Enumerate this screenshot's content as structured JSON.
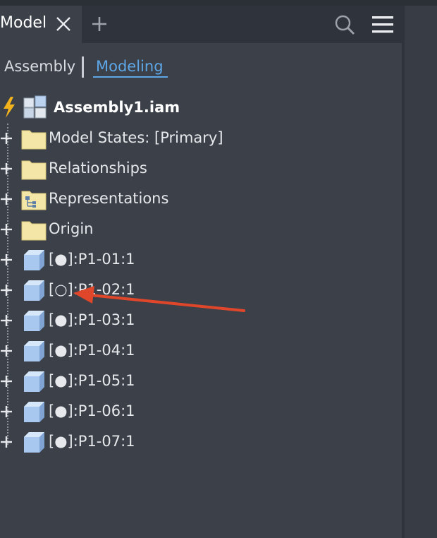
{
  "tabs": {
    "active_label": "Model",
    "close_icon": "close-icon",
    "add_icon": "plus-icon"
  },
  "toolbar": {
    "search_icon": "search-icon",
    "menu_icon": "hamburger-menu-icon"
  },
  "modes": {
    "assembly_label": "Assembly",
    "modeling_label": "Modeling",
    "active": "Modeling"
  },
  "tree": {
    "root": {
      "label": "Assembly1.iam",
      "icons": [
        "lightning-icon",
        "assembly-icon"
      ]
    },
    "items": [
      {
        "label": "Model States: [Primary]",
        "icon": "folder-icon"
      },
      {
        "label": "Relationships",
        "icon": "folder-icon"
      },
      {
        "label": "Representations",
        "icon": "representations-folder-icon"
      },
      {
        "label": "Origin",
        "icon": "folder-icon"
      },
      {
        "label": "[●]:P1-01:1",
        "icon": "part-cube-icon"
      },
      {
        "label": "[○]:P1-02:1",
        "icon": "part-cube-icon"
      },
      {
        "label": "[●]:P1-03:1",
        "icon": "part-cube-icon"
      },
      {
        "label": "[●]:P1-04:1",
        "icon": "part-cube-icon"
      },
      {
        "label": "[●]:P1-05:1",
        "icon": "part-cube-icon"
      },
      {
        "label": "[●]:P1-06:1",
        "icon": "part-cube-icon"
      },
      {
        "label": "[●]:P1-07:1",
        "icon": "part-cube-icon"
      }
    ]
  },
  "annotation": {
    "arrow_color": "#e0462a",
    "arrow_icon": "red-arrow-annotation"
  },
  "colors": {
    "panel_bg": "#3b4049",
    "tabbar_bg": "#2f343c",
    "accent": "#5ea6e6",
    "folder": "#f3e6a6",
    "cube": "#a8c8f0"
  }
}
